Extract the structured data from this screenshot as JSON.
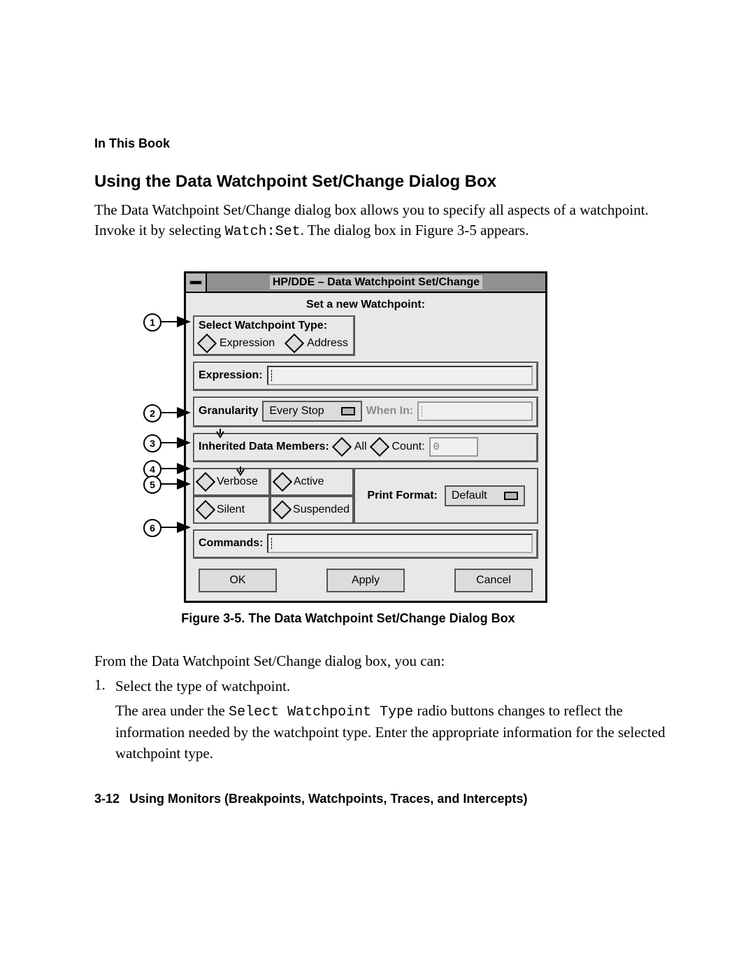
{
  "running_head": "In This Book",
  "section_title": "Using the Data Watchpoint Set/Change Dialog Box",
  "para1_a": "The Data Watchpoint Set/Change dialog box allows you to specify all aspects of a watchpoint. Invoke it by selecting ",
  "para1_code": "Watch:Set",
  "para1_b": ". The dialog box in Figure 3-5 appears.",
  "dialog": {
    "title": "HP/DDE – Data Watchpoint Set/Change",
    "subhead": "Set a new Watchpoint:",
    "type_label": "Select Watchpoint Type:",
    "type_options": {
      "expression": "Expression",
      "address": "Address"
    },
    "expression_label": "Expression:",
    "granularity_label": "Granularity",
    "granularity_value": "Every Stop",
    "when_in_label": "When In:",
    "inherited_label": "Inherited Data Members:",
    "inherited_options": {
      "all": "All",
      "count": "Count:"
    },
    "count_value": "0",
    "toggles": {
      "verbose": "Verbose",
      "active": "Active",
      "silent": "Silent",
      "suspended": "Suspended"
    },
    "print_format_label": "Print Format:",
    "print_format_value": "Default",
    "commands_label": "Commands:",
    "buttons": {
      "ok": "OK",
      "apply": "Apply",
      "cancel": "Cancel"
    }
  },
  "callouts": [
    "1",
    "2",
    "3",
    "4",
    "5",
    "6"
  ],
  "figure_caption": "Figure 3-5. The Data Watchpoint Set/Change Dialog Box",
  "after_para": "From the Data Watchpoint Set/Change dialog box, you can:",
  "list1": {
    "num": "1.",
    "line": "Select the type of watchpoint.",
    "detail_a": "The area under the ",
    "detail_code": "Select Watchpoint Type",
    "detail_b": " radio buttons changes to reflect the information needed by the watchpoint type. Enter the appropriate information for the selected watchpoint type."
  },
  "footer": {
    "page": "3-12",
    "chapter": "Using Monitors (Breakpoints, Watchpoints, Traces, and Intercepts)"
  }
}
